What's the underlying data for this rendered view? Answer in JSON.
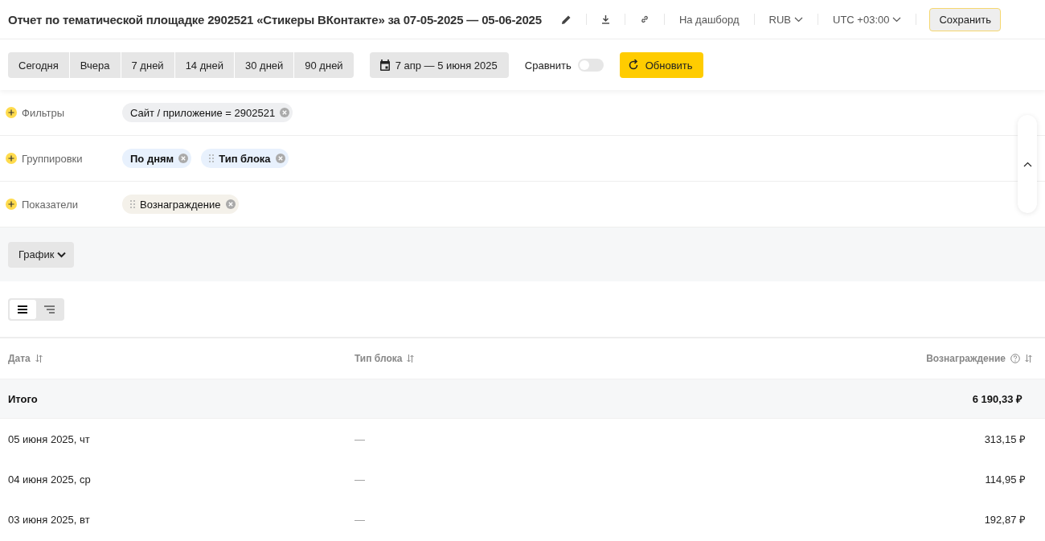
{
  "header": {
    "title": "Отчет по тематической площадке 2902521 «Стикеры ВКонтакте» за 07-05-2025 — 05-06-2025",
    "dashboard_link": "На дашборд",
    "currency": "RUB",
    "timezone": "UTC +03:00",
    "save_button": "Сохранить"
  },
  "toolbar": {
    "periods": [
      {
        "label": "Сегодня",
        "selected": false
      },
      {
        "label": "Вчера",
        "selected": false
      },
      {
        "label": "7 дней",
        "selected": false
      },
      {
        "label": "14 дней",
        "selected": false
      },
      {
        "label": "30 дней",
        "selected": false
      },
      {
        "label": "90 дней",
        "selected": false
      }
    ],
    "date_range": "7 апр — 5 июня 2025",
    "compare": {
      "label": "Сравнить",
      "on": false
    },
    "refresh_button": "Обновить"
  },
  "params": [
    {
      "label": "Фильтры",
      "chips": [
        {
          "text": "Сайт / приложение = 2902521",
          "kind": "filter",
          "draggable": false
        }
      ]
    },
    {
      "label": "Группировки",
      "chips": [
        {
          "text": "По дням",
          "kind": "grouping",
          "draggable": false
        },
        {
          "text": "Тип блока",
          "kind": "grouping",
          "draggable": true
        }
      ]
    },
    {
      "label": "Показатели",
      "chips": [
        {
          "text": "Вознаграждение",
          "kind": "metric",
          "draggable": true
        }
      ]
    }
  ],
  "chart_button": "График",
  "view_modes": [
    {
      "kind": "flat",
      "selected": true
    },
    {
      "kind": "tree",
      "selected": false
    }
  ],
  "table": {
    "columns": [
      {
        "label": "Дата",
        "help": false
      },
      {
        "label": "Тип блока",
        "help": false
      },
      {
        "label": "Вознаграждение",
        "help": true
      }
    ],
    "total": {
      "label": "Итого",
      "value": "6 190,33 ₽"
    },
    "rows": [
      [
        "05 июня 2025, чт",
        "—",
        "313,15 ₽"
      ],
      [
        "04 июня 2025, ср",
        "—",
        "114,95 ₽"
      ],
      [
        "03 июня 2025, вт",
        "—",
        "192,87 ₽"
      ]
    ]
  }
}
